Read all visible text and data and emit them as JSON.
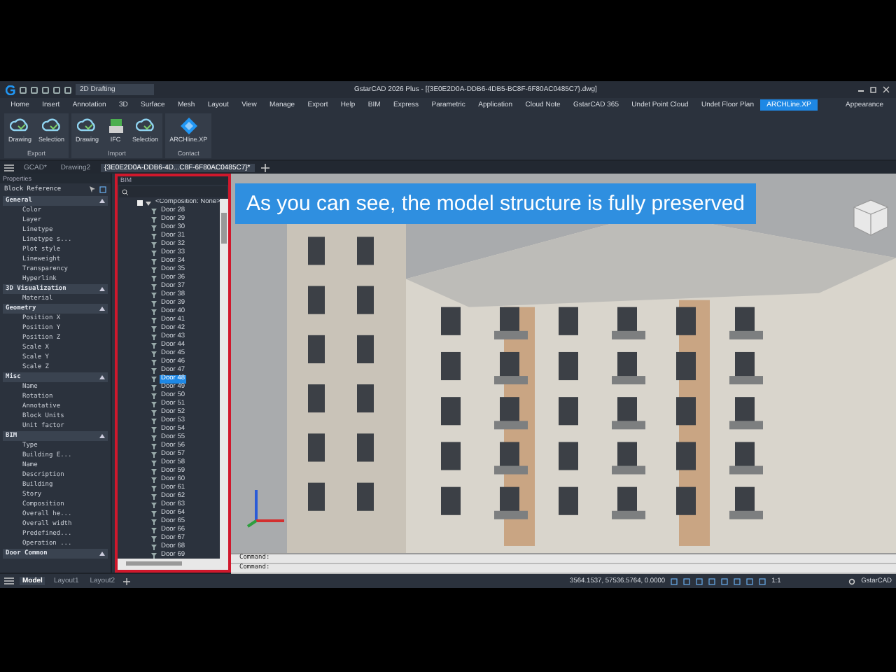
{
  "window": {
    "title": "GstarCAD 2026 Plus - [{3E0E2D0A-DDB6-4DB5-BC8F-6F80AC0485C7}.dwg]",
    "workspace": "2D Drafting"
  },
  "menu": [
    {
      "label": "Home",
      "selected": false
    },
    {
      "label": "Insert",
      "selected": false
    },
    {
      "label": "Annotation",
      "selected": false
    },
    {
      "label": "3D",
      "selected": false
    },
    {
      "label": "Surface",
      "selected": false
    },
    {
      "label": "Mesh",
      "selected": false
    },
    {
      "label": "Layout",
      "selected": false
    },
    {
      "label": "View",
      "selected": false
    },
    {
      "label": "Manage",
      "selected": false
    },
    {
      "label": "Export",
      "selected": false
    },
    {
      "label": "Help",
      "selected": false
    },
    {
      "label": "BIM",
      "selected": false
    },
    {
      "label": "Express",
      "selected": false
    },
    {
      "label": "Parametric",
      "selected": false
    },
    {
      "label": "Application",
      "selected": false
    },
    {
      "label": "Cloud Note",
      "selected": false
    },
    {
      "label": "GstarCAD 365",
      "selected": false
    },
    {
      "label": "Undet Point Cloud",
      "selected": false
    },
    {
      "label": "Undet Floor Plan",
      "selected": false
    },
    {
      "label": "ARCHLine.XP",
      "selected": true
    }
  ],
  "appearance": "Appearance",
  "ribbon": [
    {
      "group": "Export",
      "buttons": [
        {
          "label": "Drawing",
          "kind": "cloud"
        },
        {
          "label": "Selection",
          "kind": "cloud"
        }
      ]
    },
    {
      "group": "Import",
      "buttons": [
        {
          "label": "Drawing",
          "kind": "cloud"
        },
        {
          "label": "IFC",
          "kind": "ifc"
        },
        {
          "label": "Selection",
          "kind": "cloud"
        }
      ]
    },
    {
      "group": "Contact",
      "buttons": [
        {
          "label": "ARCHline.XP",
          "kind": "logo"
        }
      ]
    }
  ],
  "doc_tabs": [
    {
      "label": "GCAD*",
      "selected": false
    },
    {
      "label": "Drawing2",
      "selected": false
    },
    {
      "label": "{3E0E2D0A-DDB6-4D...C8F-6F80AC0485C7}*",
      "selected": true
    }
  ],
  "properties": {
    "title": "Properties",
    "selection": "Block Reference",
    "groups": [
      {
        "name": "General",
        "expanded": true,
        "items": [
          "Color",
          "Layer",
          "Linetype",
          "Linetype s...",
          "Plot style",
          "Lineweight",
          "Transparency",
          "Hyperlink"
        ]
      },
      {
        "name": "3D Visualization",
        "expanded": true,
        "items": [
          "Material"
        ]
      },
      {
        "name": "Geometry",
        "expanded": true,
        "items": [
          "Position X",
          "Position Y",
          "Position Z",
          "Scale X",
          "Scale Y",
          "Scale Z"
        ]
      },
      {
        "name": "Misc",
        "expanded": true,
        "items": [
          "Name",
          "Rotation",
          "Annotative",
          "Block Units",
          "Unit factor"
        ]
      },
      {
        "name": "BIM",
        "expanded": true,
        "items": [
          "Type",
          "Building E...",
          "Name",
          "Description",
          "Building",
          "Story",
          "Composition",
          "Overall he...",
          "Overall width",
          "Predefined...",
          "Operation ..."
        ]
      },
      {
        "name": "Door Common",
        "expanded": true
      }
    ]
  },
  "bim_panel": {
    "title": "BIM",
    "tree": {
      "label": "<Composition: None>",
      "checked": true,
      "expanded": true,
      "children": [
        {
          "label": "Door 28",
          "selected": false
        },
        {
          "label": "Door 29",
          "selected": false
        },
        {
          "label": "Door 30",
          "selected": false
        },
        {
          "label": "Door 31",
          "selected": false
        },
        {
          "label": "Door 32",
          "selected": false
        },
        {
          "label": "Door 33",
          "selected": false
        },
        {
          "label": "Door 34",
          "selected": false
        },
        {
          "label": "Door 35",
          "selected": false
        },
        {
          "label": "Door 36",
          "selected": false
        },
        {
          "label": "Door 37",
          "selected": false
        },
        {
          "label": "Door 38",
          "selected": false
        },
        {
          "label": "Door 39",
          "selected": false
        },
        {
          "label": "Door 40",
          "selected": false
        },
        {
          "label": "Door 41",
          "selected": false
        },
        {
          "label": "Door 42",
          "selected": false
        },
        {
          "label": "Door 43",
          "selected": false
        },
        {
          "label": "Door 44",
          "selected": false
        },
        {
          "label": "Door 45",
          "selected": false
        },
        {
          "label": "Door 46",
          "selected": false
        },
        {
          "label": "Door 47",
          "selected": false
        },
        {
          "label": "Door 48",
          "selected": true
        },
        {
          "label": "Door 49",
          "selected": false
        },
        {
          "label": "Door 50",
          "selected": false
        },
        {
          "label": "Door 51",
          "selected": false
        },
        {
          "label": "Door 52",
          "selected": false
        },
        {
          "label": "Door 53",
          "selected": false
        },
        {
          "label": "Door 54",
          "selected": false
        },
        {
          "label": "Door 55",
          "selected": false
        },
        {
          "label": "Door 56",
          "selected": false
        },
        {
          "label": "Door 57",
          "selected": false
        },
        {
          "label": "Door 58",
          "selected": false
        },
        {
          "label": "Door 59",
          "selected": false
        },
        {
          "label": "Door 60",
          "selected": false
        },
        {
          "label": "Door 61",
          "selected": false
        },
        {
          "label": "Door 62",
          "selected": false
        },
        {
          "label": "Door 63",
          "selected": false
        },
        {
          "label": "Door 64",
          "selected": false
        },
        {
          "label": "Door 65",
          "selected": false
        },
        {
          "label": "Door 66",
          "selected": false
        },
        {
          "label": "Door 67",
          "selected": false
        },
        {
          "label": "Door 68",
          "selected": false
        },
        {
          "label": "Door 69",
          "selected": false
        }
      ]
    }
  },
  "viewport": {
    "caption": "As you can see, the model structure is fully preserved"
  },
  "command_lines": [
    "Command:",
    "Command:"
  ],
  "layout_tabs": [
    {
      "label": "Model",
      "kind": "model",
      "selected": true
    },
    {
      "label": "Layout1",
      "kind": "layout",
      "selected": false
    },
    {
      "label": "Layout2",
      "kind": "layout",
      "selected": false
    }
  ],
  "status_bar": {
    "coordinates": "3564.1537, 57536.5764, 0.0000",
    "scale": "1:1",
    "brand": "GstarCAD"
  }
}
